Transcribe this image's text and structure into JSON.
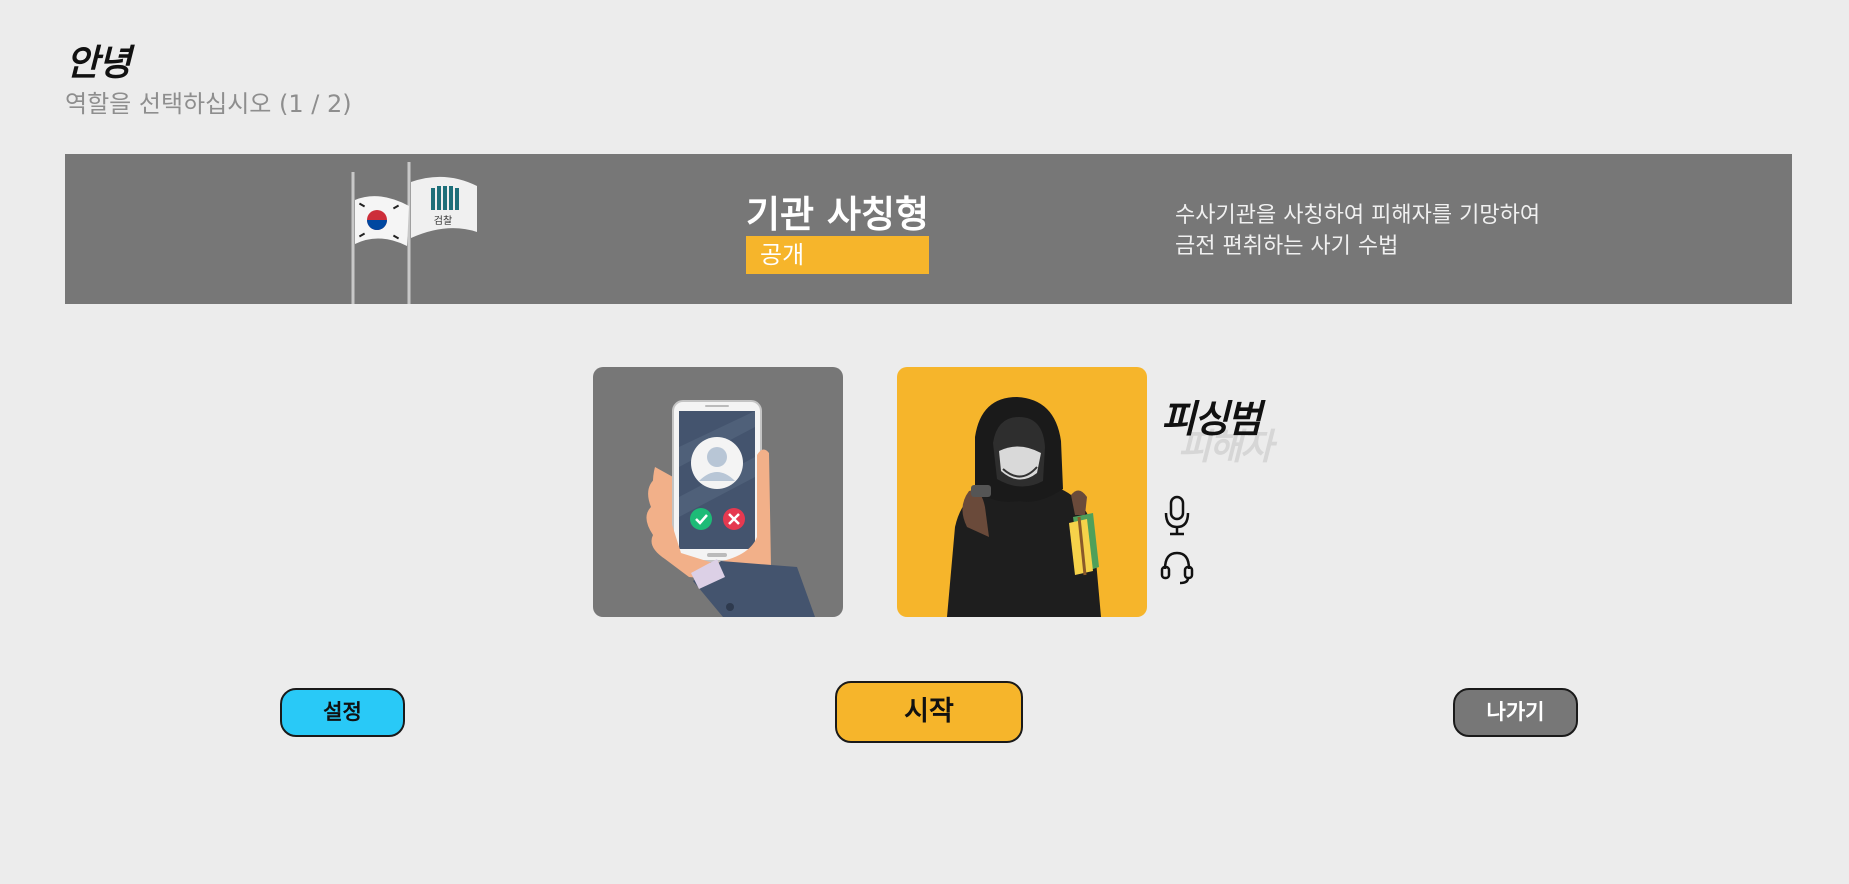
{
  "header": {
    "title": "안녕",
    "subtitle": "역할을 선택하십시오 (1 / 2)"
  },
  "banner": {
    "scenario_name": "기관 사칭형",
    "tag": "공개",
    "description_line1": "수사기관을 사칭하여 피해자를 기망하여",
    "description_line2": "금전 편취하는 사기 수법",
    "flag_text": "검찰"
  },
  "roles": {
    "current": "피싱범",
    "other": "피해자"
  },
  "buttons": {
    "settings": "설정",
    "start": "시작",
    "exit": "나가기"
  },
  "colors": {
    "background": "#ececec",
    "banner": "#777777",
    "accent_yellow": "#f6b52b",
    "settings_blue": "#29c9f7"
  },
  "icons": {
    "microphone": "microphone-icon",
    "headset": "headset-icon"
  }
}
